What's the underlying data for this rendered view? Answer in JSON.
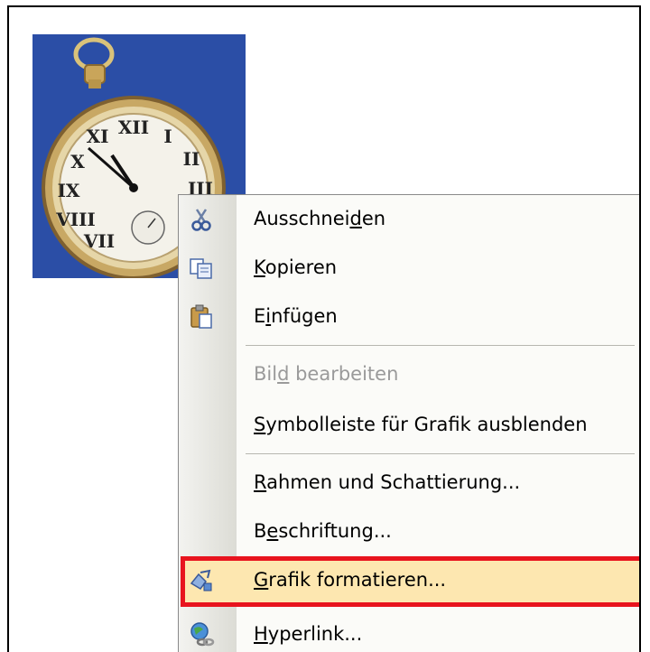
{
  "picture": {
    "description_icon": "pocket-watch-image"
  },
  "menu": {
    "items": [
      {
        "pre": "Ausschnei",
        "u": "d",
        "post": "en",
        "icon": "scissors-icon",
        "enabled": true
      },
      {
        "pre": "",
        "u": "K",
        "post": "opieren",
        "icon": "copy-icon",
        "enabled": true
      },
      {
        "pre": "E",
        "u": "i",
        "post": "nfügen",
        "icon": "paste-icon",
        "enabled": true
      },
      {
        "pre": "Bil",
        "u": "d",
        "post": " bearbeiten",
        "icon": "",
        "enabled": false
      },
      {
        "pre": "",
        "u": "S",
        "post": "ymbolleiste für Grafik ausblenden",
        "icon": "",
        "enabled": true
      },
      {
        "pre": "",
        "u": "R",
        "post": "ahmen und Schattierung...",
        "icon": "",
        "enabled": true
      },
      {
        "pre": "B",
        "u": "e",
        "post": "schriftung...",
        "icon": "",
        "enabled": true
      },
      {
        "pre": "",
        "u": "G",
        "post": "rafik formatieren...",
        "icon": "format-picture-icon",
        "enabled": true,
        "highlighted": true
      },
      {
        "pre": "",
        "u": "H",
        "post": "yperlink...",
        "icon": "hyperlink-globe-icon",
        "enabled": true
      }
    ]
  },
  "colors": {
    "highlight_border": "#e8141e",
    "highlight_fill": "#fde7b0"
  }
}
